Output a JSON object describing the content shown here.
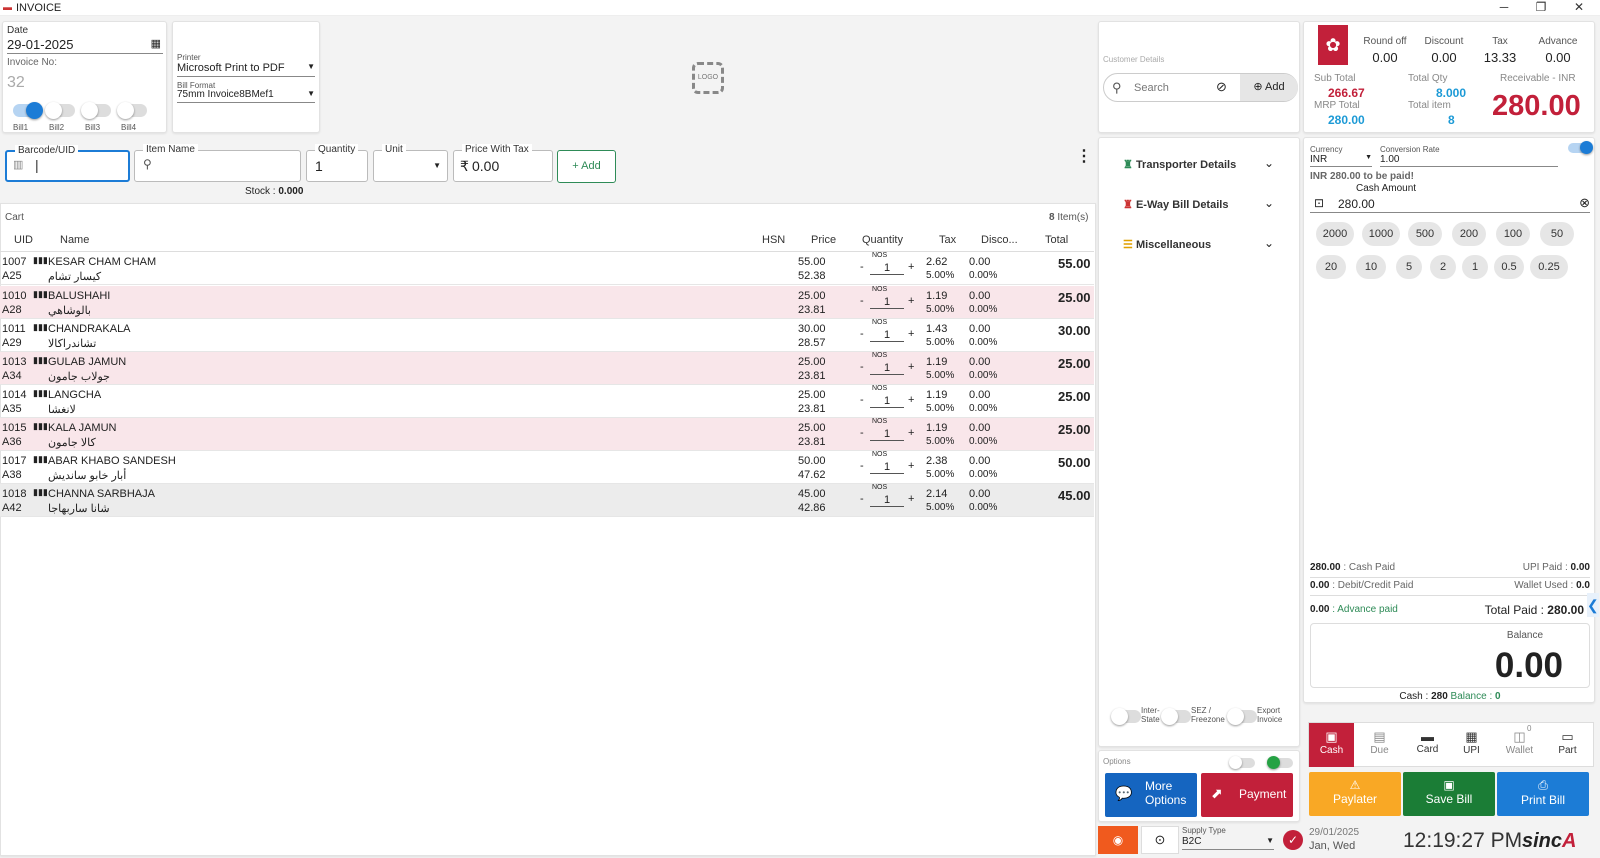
{
  "window": {
    "title": "INVOICE"
  },
  "header": {
    "date_label": "Date",
    "date_value": "29-01-2025",
    "invoice_label": "Invoice No:",
    "invoice_no": "32",
    "bills": [
      "Bill1",
      "Bill2",
      "Bill3",
      "Bill4"
    ],
    "printer_label": "Printer",
    "printer_value": "Microsoft Print to PDF",
    "format_label": "Bill Format",
    "format_value": "75mm Invoice8BMef1",
    "logo_text": "LOGO"
  },
  "entry": {
    "barcode_label": "Barcode/UID",
    "item_label": "Item Name",
    "qty_label": "Quantity",
    "qty_value": "1",
    "unit_label": "Unit",
    "price_label": "Price With Tax",
    "price_value": "0.00",
    "currency_symbol": "₹",
    "add_label": "Add",
    "stock_label": "Stock :",
    "stock_value": "0.000"
  },
  "cart": {
    "title": "Cart",
    "count": "8",
    "count_suffix": "Item(s)",
    "columns": {
      "uid": "UID",
      "name": "Name",
      "hsn": "HSN",
      "price": "Price",
      "qty": "Quantity",
      "tax": "Tax",
      "disc": "Disco...",
      "total": "Total"
    },
    "rows": [
      {
        "uid": "1007",
        "code": "A25",
        "name": "KESAR CHAM CHAM",
        "alt": "كيسار تشام",
        "price": "55.00",
        "base": "52.38",
        "unit": "NOS",
        "qty": "1",
        "tax": "2.62",
        "taxp": "5.00%",
        "disc": "0.00",
        "discp": "0.00%",
        "total": "55.00"
      },
      {
        "uid": "1010",
        "code": "A28",
        "name": "BALUSHAHI",
        "alt": "بالوشاهي",
        "price": "25.00",
        "base": "23.81",
        "unit": "NOS",
        "qty": "1",
        "tax": "1.19",
        "taxp": "5.00%",
        "disc": "0.00",
        "discp": "0.00%",
        "total": "25.00"
      },
      {
        "uid": "1011",
        "code": "A29",
        "name": "CHANDRAKALA",
        "alt": "تشاندراكالا",
        "price": "30.00",
        "base": "28.57",
        "unit": "NOS",
        "qty": "1",
        "tax": "1.43",
        "taxp": "5.00%",
        "disc": "0.00",
        "discp": "0.00%",
        "total": "30.00"
      },
      {
        "uid": "1013",
        "code": "A34",
        "name": "GULAB JAMUN",
        "alt": "جولاب جامون",
        "price": "25.00",
        "base": "23.81",
        "unit": "NOS",
        "qty": "1",
        "tax": "1.19",
        "taxp": "5.00%",
        "disc": "0.00",
        "discp": "0.00%",
        "total": "25.00"
      },
      {
        "uid": "1014",
        "code": "A35",
        "name": "LANGCHA",
        "alt": "لانغشا",
        "price": "25.00",
        "base": "23.81",
        "unit": "NOS",
        "qty": "1",
        "tax": "1.19",
        "taxp": "5.00%",
        "disc": "0.00",
        "discp": "0.00%",
        "total": "25.00"
      },
      {
        "uid": "1015",
        "code": "A36",
        "name": "KALA JAMUN",
        "alt": "كالا جامون",
        "price": "25.00",
        "base": "23.81",
        "unit": "NOS",
        "qty": "1",
        "tax": "1.19",
        "taxp": "5.00%",
        "disc": "0.00",
        "discp": "0.00%",
        "total": "25.00"
      },
      {
        "uid": "1017",
        "code": "A38",
        "name": "ABAR KHABO SANDESH",
        "alt": "أبار خابو سانديش",
        "price": "50.00",
        "base": "47.62",
        "unit": "NOS",
        "qty": "1",
        "tax": "2.38",
        "taxp": "5.00%",
        "disc": "0.00",
        "discp": "0.00%",
        "total": "50.00"
      },
      {
        "uid": "1018",
        "code": "A42",
        "name": "CHANNA SARBHAJA",
        "alt": "شانا ساربهاجا",
        "price": "45.00",
        "base": "42.86",
        "unit": "NOS",
        "qty": "1",
        "tax": "2.14",
        "taxp": "5.00%",
        "disc": "0.00",
        "discp": "0.00%",
        "total": "45.00"
      }
    ]
  },
  "customer": {
    "label": "Customer Details",
    "search_placeholder": "Search",
    "add_label": "Add"
  },
  "sections": [
    "Transporter Details",
    "E-Way Bill Details",
    "Miscellaneous"
  ],
  "toggles": {
    "inter_state": [
      "Inter-",
      "State"
    ],
    "sez": [
      "SEZ /",
      "Freezone"
    ],
    "export": [
      "Export",
      "Invoice"
    ]
  },
  "options": {
    "label": "Options",
    "more": [
      "More",
      "Options"
    ],
    "payment": "Payment"
  },
  "supply": {
    "label": "Supply Type",
    "value": "B2C"
  },
  "summary": {
    "round_label": "Round off",
    "round": "0.00",
    "discount_label": "Discount",
    "discount": "0.00",
    "tax_label": "Tax",
    "tax": "13.33",
    "advance_label": "Advance",
    "advance": "0.00",
    "subtotal_label": "Sub Total",
    "subtotal": "266.67",
    "qty_label": "Total Qty",
    "qty": "8.000",
    "receivable_label": "Receivable - INR",
    "receivable": "280.00",
    "mrp_label": "MRP Total",
    "mrp": "280.00",
    "items_label": "Total item",
    "items": "8"
  },
  "payment": {
    "currency_label": "Currency",
    "currency": "INR",
    "rate_label": "Conversion Rate",
    "rate": "1.00",
    "to_pay": "INR 280.00 to be paid!",
    "cash_label": "Cash Amount",
    "cash": "280.00",
    "denoms_row1": [
      "2000",
      "1000",
      "500",
      "200",
      "100",
      "50"
    ],
    "denoms_row2": [
      "20",
      "10",
      "5",
      "2",
      "1",
      "0.5",
      "0.25"
    ],
    "cash_paid": "280.00",
    "cash_paid_label": ": Cash Paid",
    "upi_paid_label": "UPI Paid :",
    "upi_paid": "0.00",
    "card_paid": "0.00",
    "card_paid_label": ": Debit/Credit Paid",
    "wallet_label": "Wallet Used :",
    "wallet": "0.0",
    "adv_paid": "0.00",
    "adv_paid_label": ": Advance paid",
    "total_paid_label": "Total Paid :",
    "total_paid": "280.00",
    "balance_label": "Balance",
    "balance": "0.00",
    "cash_line_label": "Cash :",
    "cash_line": "280",
    "bal_line_label": "Balance :",
    "bal_line": "0",
    "methods": [
      "Cash",
      "Due",
      "Card",
      "UPI",
      "Wallet",
      "Part"
    ],
    "wallet_badge": "0"
  },
  "actions": {
    "paylater": "Paylater",
    "save": "Save Bill",
    "print": "Print Bill"
  },
  "status": {
    "date": "29/01/2025",
    "day": "Jan, Wed",
    "time": "12:19:27 PM",
    "brand": "sinc"
  }
}
